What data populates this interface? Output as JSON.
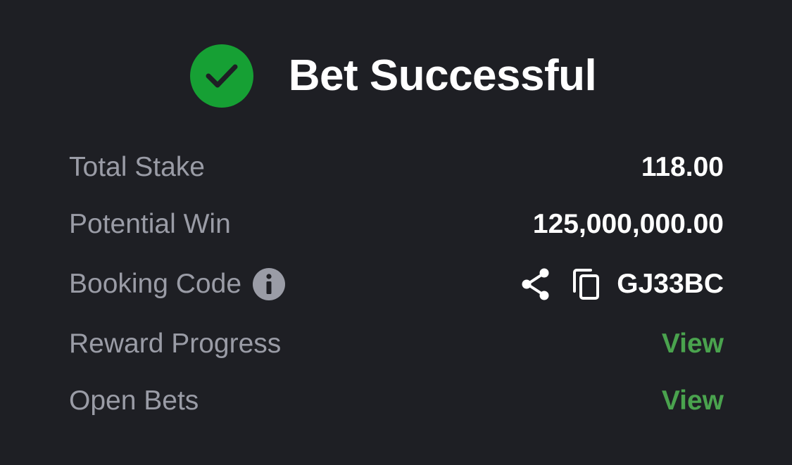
{
  "header": {
    "title": "Bet Successful",
    "status_icon": "check-circle-icon"
  },
  "summary": {
    "total_stake": {
      "label": "Total Stake",
      "value": "118.00"
    },
    "potential_win": {
      "label": "Potential Win",
      "value": "125,000,000.00"
    },
    "booking_code": {
      "label": "Booking Code",
      "code": "GJ33BC",
      "info_icon": "info-icon",
      "share_icon": "share-icon",
      "copy_icon": "copy-icon"
    },
    "reward_progress": {
      "label": "Reward Progress",
      "link": "View"
    },
    "open_bets": {
      "label": "Open Bets",
      "link": "View"
    }
  },
  "colors": {
    "background": "#1e1f24",
    "success": "#16a034",
    "link": "#4aa34e",
    "label": "#9a9ca6",
    "value": "#ffffff"
  }
}
